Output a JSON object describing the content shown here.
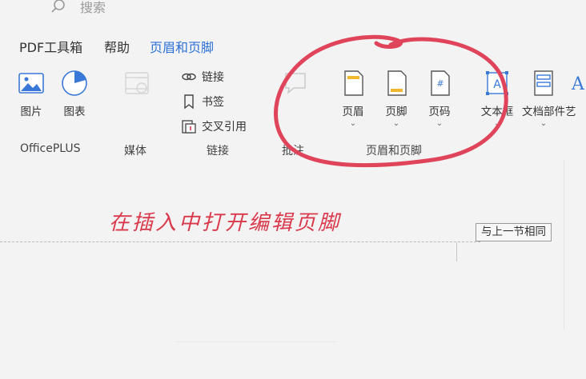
{
  "search": {
    "label": "搜索"
  },
  "menu": {
    "tabs": [
      {
        "label": "PDF工具箱",
        "active": false
      },
      {
        "label": "帮助",
        "active": false
      },
      {
        "label": "页眉和页脚",
        "active": true
      }
    ]
  },
  "ribbon": {
    "picture": "图片",
    "chart": "图表",
    "link": "链接",
    "bookmark": "书签",
    "cross_ref": "交叉引用",
    "comment": "批注",
    "header": "页眉",
    "footer": "页脚",
    "page_number": "页码",
    "textbox": "文本框",
    "doc_parts": "文档部件",
    "art_partial": "艺",
    "caret": "⌄",
    "groups": {
      "officeplus": "OfficePLUS",
      "media": "媒体",
      "links": "链接",
      "comment": "批注",
      "header_footer": "页眉和页脚"
    }
  },
  "annotation": {
    "text": "在插入中打开编辑页脚",
    "color": "#d9394b"
  },
  "document": {
    "same_as_previous": "与上一节相同"
  },
  "colors": {
    "accent": "#2b6fd6",
    "ink": "#d9394b",
    "background": "#f3f3f3"
  }
}
